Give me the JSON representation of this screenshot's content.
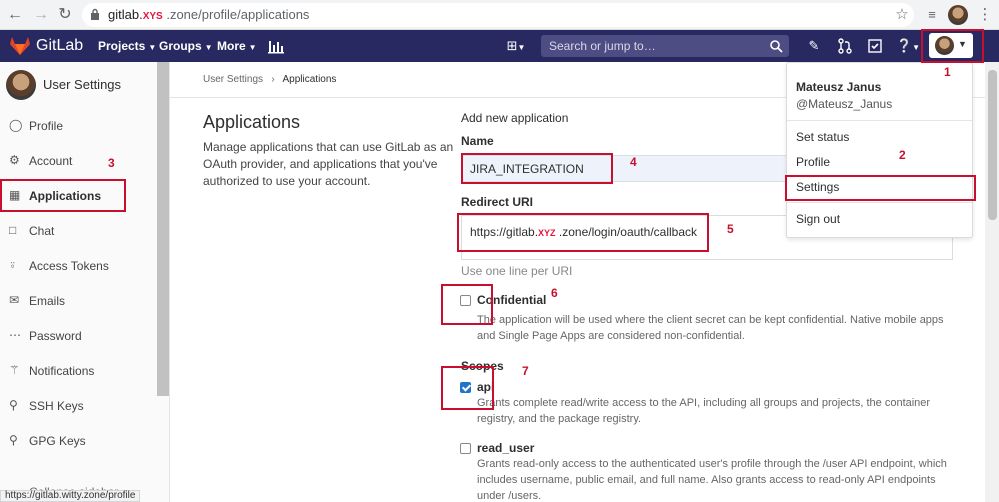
{
  "browser": {
    "url_host": "gitlab.",
    "url_redacted": "XYS",
    "url_rest": ".zone/profile/applications"
  },
  "header": {
    "brand": "GitLab",
    "nav": [
      "Projects",
      "Groups",
      "More"
    ],
    "search_placeholder": "Search or jump to…"
  },
  "sidebar": {
    "title": "User Settings",
    "items": [
      {
        "label": "Profile",
        "icon": "profile-icon"
      },
      {
        "label": "Account",
        "icon": "account-icon"
      },
      {
        "label": "Applications",
        "icon": "applications-icon",
        "active": true
      },
      {
        "label": "Chat",
        "icon": "chat-icon"
      },
      {
        "label": "Access Tokens",
        "icon": "access-tokens-icon"
      },
      {
        "label": "Emails",
        "icon": "emails-icon"
      },
      {
        "label": "Password",
        "icon": "password-icon"
      },
      {
        "label": "Notifications",
        "icon": "notifications-icon"
      },
      {
        "label": "SSH Keys",
        "icon": "ssh-keys-icon"
      },
      {
        "label": "GPG Keys",
        "icon": "gpg-keys-icon"
      }
    ],
    "collapse_label": "Collapse sidebar"
  },
  "breadcrumb": {
    "parent": "User Settings",
    "current": "Applications"
  },
  "page": {
    "title": "Applications",
    "description": "Manage applications that can use GitLab as an OAuth provider, and applications that you've authorized to use your account."
  },
  "form": {
    "title": "Add new application",
    "name_label": "Name",
    "name_value": "JIRA_INTEGRATION",
    "redirect_label": "Redirect URI",
    "redirect_prefix": "https://gitlab.",
    "redirect_redacted": "XYZ",
    "redirect_suffix": ".zone/login/oauth/callback",
    "redirect_help": "Use one line per URI",
    "confidential_label": "Confidential",
    "confidential_checked": false,
    "confidential_help": "The application will be used where the client secret can be kept confidential. Native mobile apps and Single Page Apps are considered non-confidential.",
    "scopes_label": "Scopes",
    "scopes": [
      {
        "label": "api",
        "checked": true,
        "help": "Grants complete read/write access to the API, including all groups and projects, the container registry, and the package registry."
      },
      {
        "label": "read_user",
        "checked": false,
        "help": "Grants read-only access to the authenticated user's profile through the /user API endpoint, which includes username, public email, and full name. Also grants access to read-only API endpoints under /users."
      }
    ]
  },
  "user_dropdown": {
    "name": "Mateusz Janus",
    "handle": "@Mateusz_Janus",
    "items": [
      "Set status",
      "Profile",
      "Settings",
      "Sign out"
    ]
  },
  "annotations": [
    "1",
    "2",
    "3",
    "4",
    "5",
    "6",
    "7"
  ],
  "status_url": "https://gitlab.witty.zone/profile",
  "colors": {
    "header_bg": "#292961",
    "annotation": "#c8102e",
    "checkbox_checked": "#1f75cb"
  }
}
